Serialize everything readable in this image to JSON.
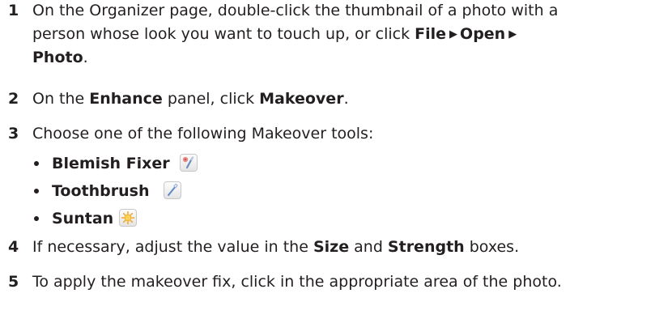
{
  "steps": [
    {
      "num": "1",
      "line1": "On the Organizer page, double-click the thumbnail of a photo with a",
      "line2_pre": "person whose look you want to touch up, or click ",
      "line2_file": "File",
      "line2_open": "Open",
      "line3_photo": "Photo",
      "line3_post": "."
    },
    {
      "num": "2",
      "pre": "On the ",
      "bold1": "Enhance",
      "mid": " panel, click ",
      "bold2": "Makeover",
      "post": "."
    },
    {
      "num": "3",
      "text": "Choose one of the following Makeover tools:",
      "tools": [
        {
          "label": "Blemish Fixer",
          "icon": "blemish-fixer-icon"
        },
        {
          "label": "Toothbrush",
          "icon": "toothbrush-icon"
        },
        {
          "label": "Suntan",
          "icon": "suntan-icon"
        }
      ]
    },
    {
      "num": "4",
      "pre": "If necessary, adjust the value in the ",
      "bold1": "Size",
      "mid": " and ",
      "bold2": "Strength",
      "post": " boxes."
    },
    {
      "num": "5",
      "text": "To apply the makeover fix, click in the appropriate area of the photo."
    }
  ]
}
